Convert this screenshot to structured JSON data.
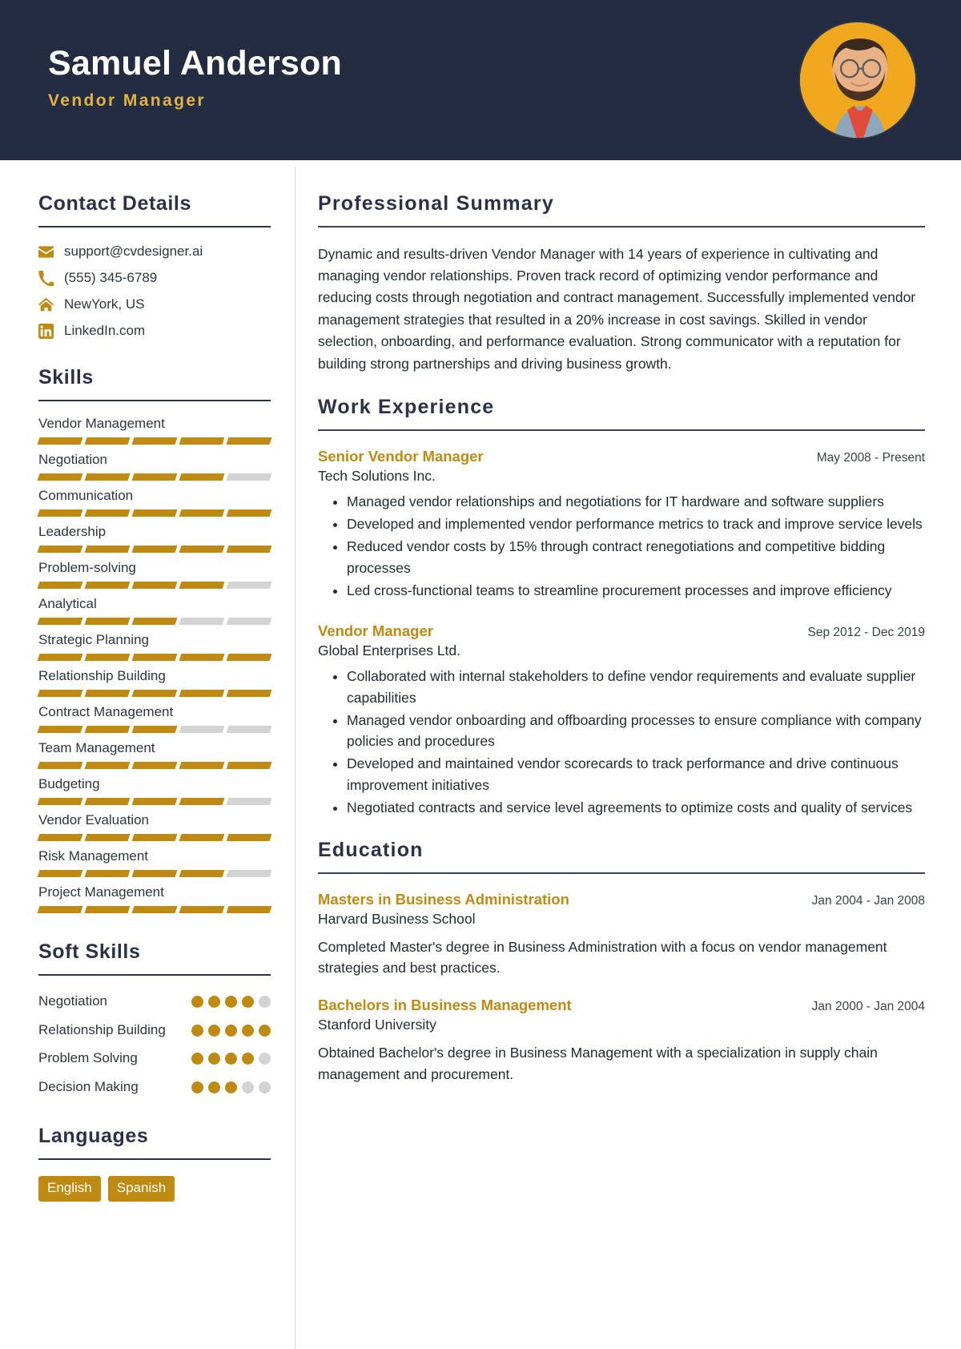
{
  "header": {
    "name": "Samuel Anderson",
    "job_title": "Vendor Manager",
    "avatar_alt": "profile-photo",
    "bg_color": "#232c40",
    "accent_color": "#e3b441"
  },
  "theme": {
    "gold": "#bf8a11",
    "navy": "#2b3248",
    "muted": "#d3d3d3"
  },
  "sidebar": {
    "contact": {
      "title": "Contact Details",
      "items": [
        {
          "icon": "email-icon",
          "value": "support@cvdesigner.ai"
        },
        {
          "icon": "phone-icon",
          "value": "(555) 345-6789"
        },
        {
          "icon": "home-icon",
          "value": "NewYork, US"
        },
        {
          "icon": "linkedin-icon",
          "value": "LinkedIn.com"
        }
      ]
    },
    "skills": {
      "title": "Skills",
      "max": 5,
      "items": [
        {
          "name": "Vendor Management",
          "level": 5
        },
        {
          "name": "Negotiation",
          "level": 4
        },
        {
          "name": "Communication",
          "level": 5
        },
        {
          "name": "Leadership",
          "level": 5
        },
        {
          "name": "Problem-solving",
          "level": 4
        },
        {
          "name": "Analytical",
          "level": 3
        },
        {
          "name": "Strategic Planning",
          "level": 5
        },
        {
          "name": "Relationship Building",
          "level": 5
        },
        {
          "name": "Contract Management",
          "level": 3
        },
        {
          "name": "Team Management",
          "level": 5
        },
        {
          "name": "Budgeting",
          "level": 4
        },
        {
          "name": "Vendor Evaluation",
          "level": 5
        },
        {
          "name": "Risk Management",
          "level": 4
        },
        {
          "name": "Project Management",
          "level": 5
        }
      ]
    },
    "soft_skills": {
      "title": "Soft Skills",
      "max": 5,
      "items": [
        {
          "name": "Negotiation",
          "level": 4
        },
        {
          "name": "Relationship Building",
          "level": 5
        },
        {
          "name": "Problem Solving",
          "level": 4
        },
        {
          "name": "Decision Making",
          "level": 3
        }
      ]
    },
    "languages": {
      "title": "Languages",
      "items": [
        "English",
        "Spanish"
      ]
    }
  },
  "main": {
    "summary": {
      "title": "Professional Summary",
      "text": "Dynamic and results-driven Vendor Manager with 14 years of experience in cultivating and managing vendor relationships. Proven track record of optimizing vendor performance and reducing costs through negotiation and contract management. Successfully implemented vendor management strategies that resulted in a 20% increase in cost savings. Skilled in vendor selection, onboarding, and performance evaluation. Strong communicator with a reputation for building strong partnerships and driving business growth."
    },
    "work": {
      "title": "Work Experience",
      "entries": [
        {
          "role": "Senior Vendor Manager",
          "date": "May 2008 - Present",
          "org": "Tech Solutions Inc.",
          "bullets": [
            "Managed vendor relationships and negotiations for IT hardware and software suppliers",
            "Developed and implemented vendor performance metrics to track and improve service levels",
            "Reduced vendor costs by 15% through contract renegotiations and competitive bidding processes",
            "Led cross-functional teams to streamline procurement processes and improve efficiency"
          ]
        },
        {
          "role": "Vendor Manager",
          "date": "Sep 2012 - Dec 2019",
          "org": "Global Enterprises Ltd.",
          "bullets": [
            "Collaborated with internal stakeholders to define vendor requirements and evaluate supplier capabilities",
            "Managed vendor onboarding and offboarding processes to ensure compliance with company policies and procedures",
            "Developed and maintained vendor scorecards to track performance and drive continuous improvement initiatives",
            "Negotiated contracts and service level agreements to optimize costs and quality of services"
          ]
        }
      ]
    },
    "education": {
      "title": "Education",
      "entries": [
        {
          "degree": "Masters in Business Administration",
          "date": "Jan 2004 - Jan 2008",
          "school": "Harvard Business School",
          "description": "Completed Master's degree in Business Administration with a focus on vendor management strategies and best practices."
        },
        {
          "degree": "Bachelors in Business Management",
          "date": "Jan 2000 - Jan 2004",
          "school": "Stanford University",
          "description": "Obtained Bachelor's degree in Business Management with a specialization in supply chain management and procurement."
        }
      ]
    }
  }
}
